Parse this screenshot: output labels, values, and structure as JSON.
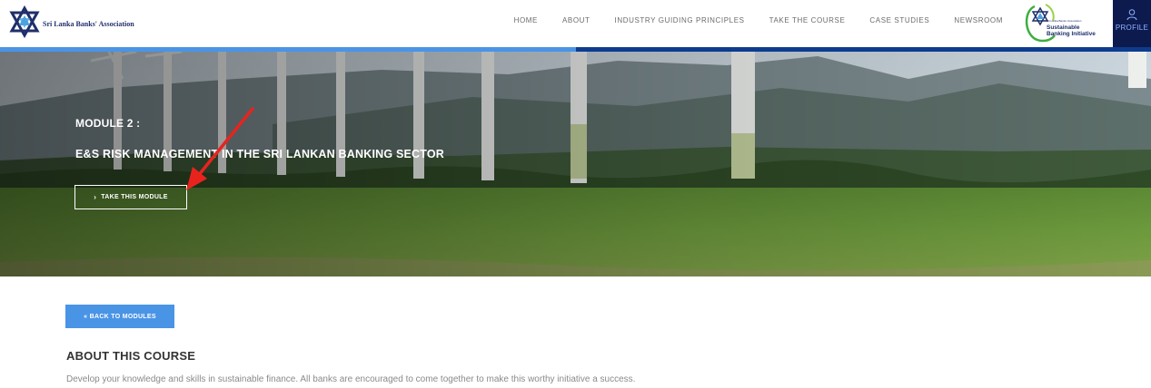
{
  "header": {
    "org_name": "Sri Lanka Banks' Association",
    "nav": [
      "HOME",
      "ABOUT",
      "INDUSTRY GUIDING PRINCIPLES",
      "TAKE THE COURSE",
      "CASE STUDIES",
      "NEWSROOM"
    ],
    "partner_logo_line1": "Sustainable",
    "partner_logo_line2": "Banking Initiative",
    "partner_logo_small": "Sri Lanka Banks' Association",
    "profile_label": "PROFILE"
  },
  "hero": {
    "module_label": "MODULE 2 :",
    "module_title": "E&S RISK MANAGEMENT IN THE SRI LANKAN BANKING SECTOR",
    "take_button": "TAKE THIS MODULE",
    "take_button_icon": "chevron-right-icon"
  },
  "content": {
    "back_button": "« BACK TO MODULES",
    "about_title": "ABOUT THIS COURSE",
    "about_desc": "Develop your knowledge and skills in sustainable finance. All banks are encouraged to come together to make this worthy initiative a success."
  },
  "colors": {
    "accent_blue": "#4a94e6",
    "dark_navy": "#0d1a4d",
    "annotation_arrow": "#e8231e"
  }
}
